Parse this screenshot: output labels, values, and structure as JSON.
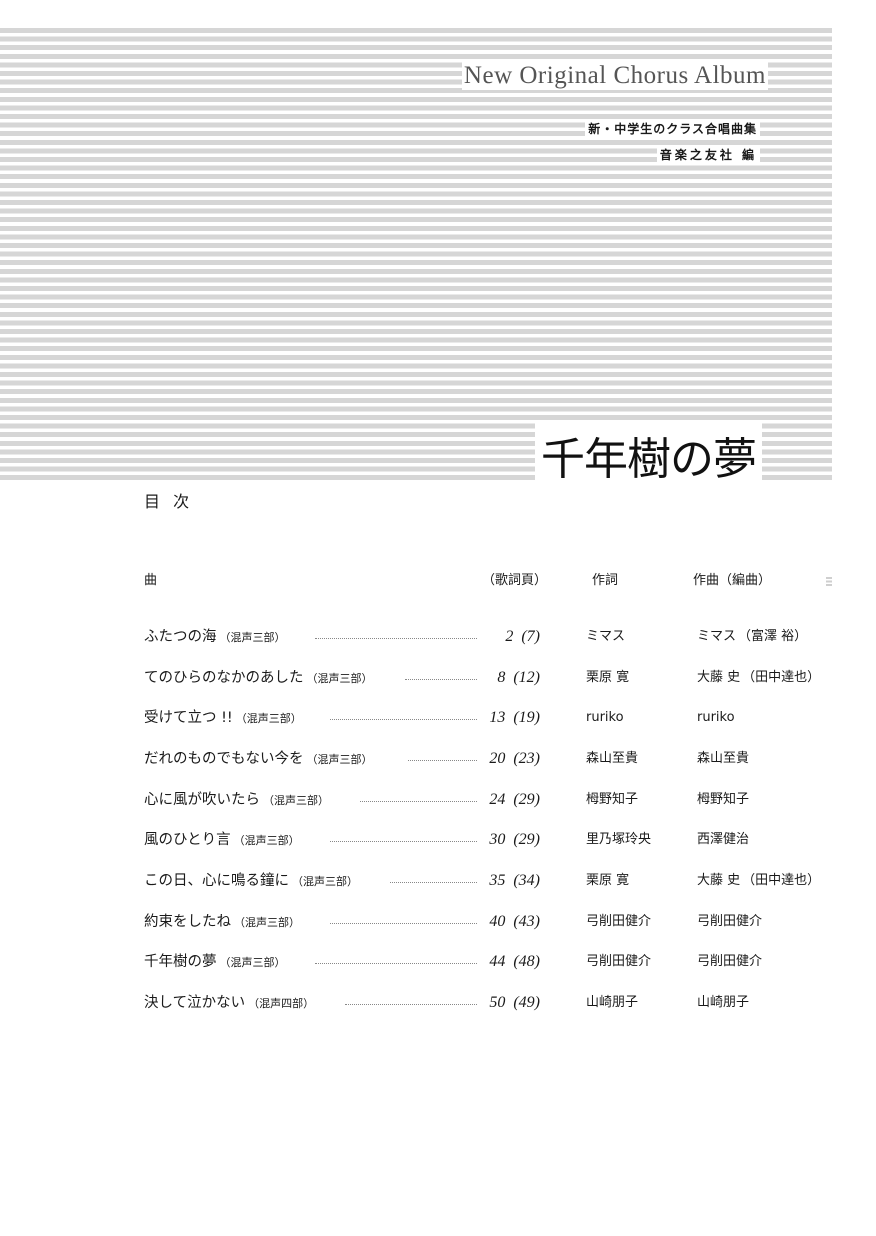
{
  "header": {
    "series_title": "New Original Chorus Album",
    "subtitle": "新・中学生のクラス合唱曲集",
    "editor": "音楽之友社 編",
    "album_title": "千年樹の夢"
  },
  "toc": {
    "heading": "目 次",
    "columns": {
      "song": "曲",
      "page": "（歌詞頁）",
      "lyricist": "作詞",
      "composer": "作曲（編曲）"
    },
    "rows": [
      {
        "title": "ふたつの海",
        "voicing": "（混声三部）",
        "page": "2",
        "lyric_page": "(7)",
        "lyricist": "ミマス",
        "composer": "ミマス",
        "arranger": "（富澤 裕）"
      },
      {
        "title": "てのひらのなかのあした",
        "voicing": "（混声三部）",
        "page": "8",
        "lyric_page": "(12)",
        "lyricist": "栗原 寛",
        "composer": "大藤 史",
        "arranger": "（田中達也）"
      },
      {
        "title": "受けて立つ !!",
        "voicing": "（混声三部）",
        "page": "13",
        "lyric_page": "(19)",
        "lyricist": "ruriko",
        "composer": "ruriko",
        "arranger": ""
      },
      {
        "title": "だれのものでもない今を",
        "voicing": "（混声三部）",
        "page": "20",
        "lyric_page": "(23)",
        "lyricist": "森山至貴",
        "composer": "森山至貴",
        "arranger": ""
      },
      {
        "title": "心に風が吹いたら",
        "voicing": "（混声三部）",
        "page": "24",
        "lyric_page": "(29)",
        "lyricist": "栂野知子",
        "composer": "栂野知子",
        "arranger": ""
      },
      {
        "title": "風のひとり言",
        "voicing": "（混声三部）",
        "page": "30",
        "lyric_page": "(29)",
        "lyricist": "里乃塚玲央",
        "composer": "西澤健治",
        "arranger": ""
      },
      {
        "title": "この日、心に鳴る鐘に",
        "voicing": "（混声三部）",
        "page": "35",
        "lyric_page": "(34)",
        "lyricist": "栗原 寛",
        "composer": "大藤 史",
        "arranger": "（田中達也）"
      },
      {
        "title": "約束をしたね",
        "voicing": "（混声三部）",
        "page": "40",
        "lyric_page": "(43)",
        "lyricist": "弓削田健介",
        "composer": "弓削田健介",
        "arranger": ""
      },
      {
        "title": "千年樹の夢",
        "voicing": "（混声三部）",
        "page": "44",
        "lyric_page": "(48)",
        "lyricist": "弓削田健介",
        "composer": "弓削田健介",
        "arranger": ""
      },
      {
        "title": "決して泣かない",
        "voicing": "（混声四部）",
        "page": "50",
        "lyric_page": "(49)",
        "lyricist": "山崎朋子",
        "composer": "山崎朋子",
        "arranger": ""
      }
    ]
  }
}
